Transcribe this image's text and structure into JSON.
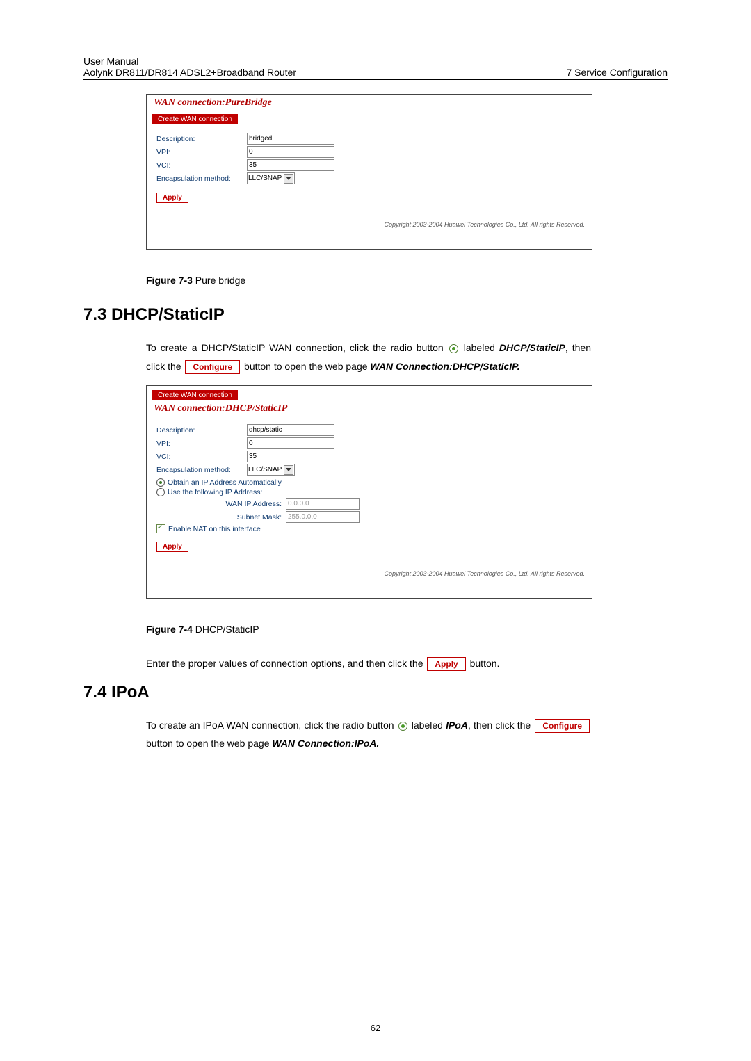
{
  "header": {
    "line1": "User Manual",
    "line2_left": "Aolynk DR811/DR814 ADSL2+Broadband Router",
    "line2_right": "7  Service Configuration"
  },
  "fig73": {
    "title": "WAN connection:PureBridge",
    "tab": "Create WAN connection",
    "labels": {
      "description": "Description:",
      "vpi": "VPI:",
      "vci": "VCI:",
      "encap": "Encapsulation method:"
    },
    "values": {
      "description": "bridged",
      "vpi": "0",
      "vci": "35",
      "encap": "LLC/SNAP"
    },
    "apply": "Apply",
    "copyright": "Copyright 2003-2004 Huawei Technologies Co., Ltd. All rights Reserved."
  },
  "caption73": {
    "figure": "Figure 7-3 ",
    "text": "Pure bridge"
  },
  "section73": "7.3  DHCP/StaticIP",
  "para73": {
    "p1a": "To create a DHCP/StaticIP WAN connection, click the radio button ",
    "p1b": " labeled ",
    "p1c": "DHCP/StaticIP",
    "p1d": ", then click the ",
    "configure": "Configure",
    "p1e": " button to open the web page ",
    "p1f": "WAN Connection:DHCP/StaticIP."
  },
  "fig74": {
    "tab": "Create WAN connection",
    "title": "WAN connection:DHCP/StaticIP",
    "labels": {
      "description": "Description:",
      "vpi": "VPI:",
      "vci": "VCI:",
      "encap": "Encapsulation method:",
      "obtain": "Obtain an IP Address Automatically",
      "usefollowing": "Use the following IP Address:",
      "wanip": "WAN IP Address:",
      "subnet": "Subnet Mask:",
      "enablenat": "Enable NAT on this interface"
    },
    "values": {
      "description": "dhcp/static",
      "vpi": "0",
      "vci": "35",
      "encap": "LLC/SNAP",
      "wanip": "0.0.0.0",
      "subnet": "255.0.0.0"
    },
    "apply": "Apply",
    "copyright": "Copyright 2003-2004 Huawei Technologies Co., Ltd. All rights Reserved."
  },
  "caption74": {
    "figure": "Figure 7-4 ",
    "text": "DHCP/StaticIP"
  },
  "para_after74": {
    "a": "Enter the proper values of connection options, and then click the ",
    "apply": "Apply",
    "b": " button."
  },
  "section74": "7.4  IPoA",
  "para74": {
    "a": "To create an IPoA WAN connection, click the radio button ",
    "b": " labeled ",
    "c": "IPoA",
    "d": ", then click the ",
    "configure": "Configure",
    "e": " button to open the web page ",
    "f": "WAN Connection:IPoA."
  },
  "page_num": "62"
}
